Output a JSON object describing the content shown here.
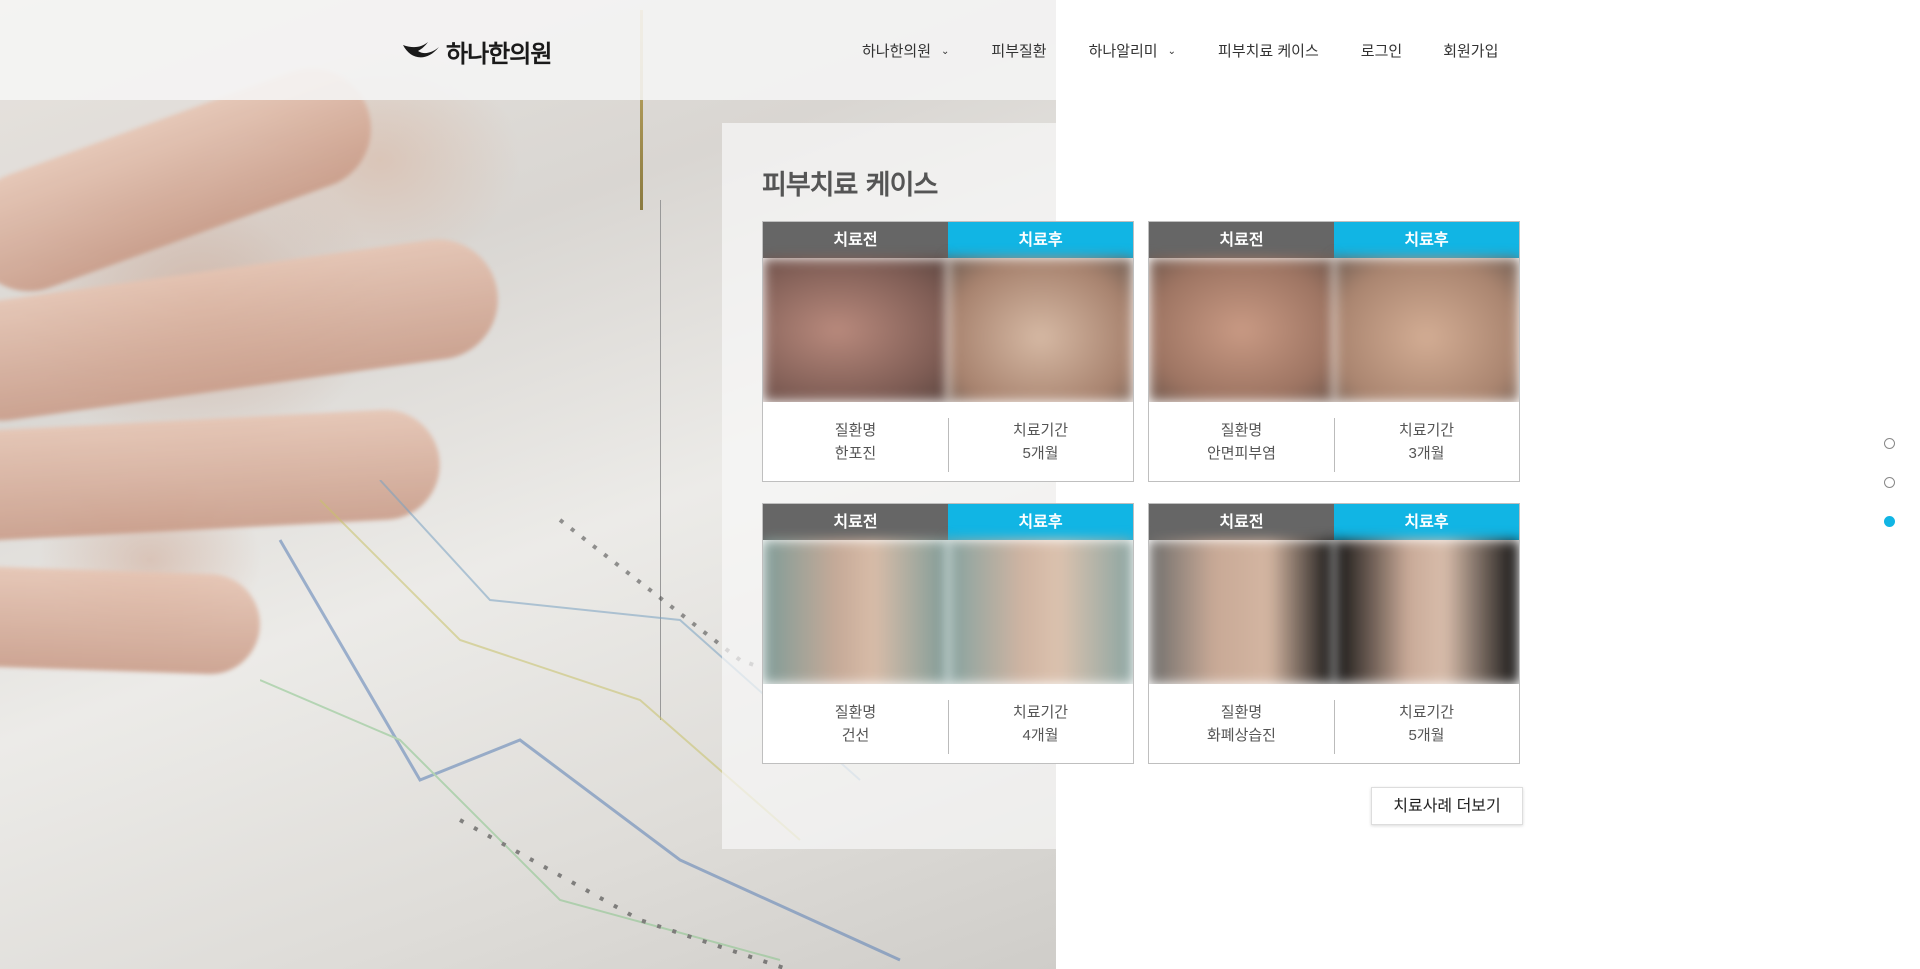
{
  "header": {
    "logo_text": "하나한의원",
    "nav": [
      {
        "label": "하나한의원",
        "has_dropdown": true
      },
      {
        "label": "피부질환",
        "has_dropdown": false
      },
      {
        "label": "하나알리미",
        "has_dropdown": true
      },
      {
        "label": "피부치료 케이스",
        "has_dropdown": false
      },
      {
        "label": "로그인",
        "has_dropdown": false
      },
      {
        "label": "회원가입",
        "has_dropdown": false
      }
    ]
  },
  "section": {
    "title": "피부치료 케이스",
    "more_button": "치료사례 더보기"
  },
  "cases": [
    {
      "before_label": "치료전",
      "after_label": "치료후",
      "disease_label": "질환명",
      "disease": "한포진",
      "period_label": "치료기간",
      "period": "5개월"
    },
    {
      "before_label": "치료전",
      "after_label": "치료후",
      "disease_label": "질환명",
      "disease": "안면피부염",
      "period_label": "치료기간",
      "period": "3개월"
    },
    {
      "before_label": "치료전",
      "after_label": "치료후",
      "disease_label": "질환명",
      "disease": "건선",
      "period_label": "치료기간",
      "period": "4개월"
    },
    {
      "before_label": "치료전",
      "after_label": "치료후",
      "disease_label": "질환명",
      "disease": "화폐상습진",
      "period_label": "치료기간",
      "period": "5개월"
    }
  ],
  "pager": {
    "count": 3,
    "active_index": 2
  },
  "colors": {
    "accent": "#11b5e4",
    "before": "#666666"
  }
}
